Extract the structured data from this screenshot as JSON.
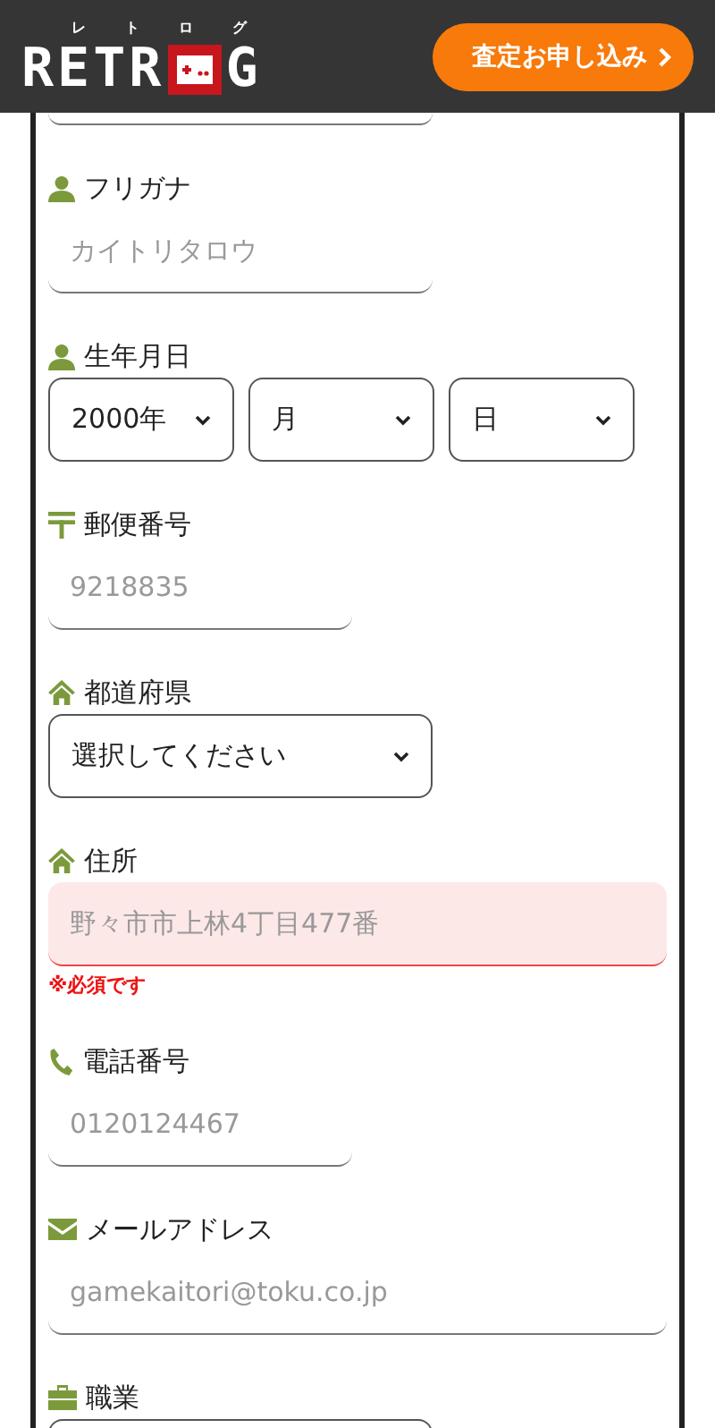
{
  "header": {
    "logo": {
      "before": "RETR",
      "after": "G",
      "ruby": [
        "レ",
        "ト",
        "ロ",
        "グ"
      ]
    },
    "cta": {
      "label": "査定お申し込み"
    }
  },
  "fields": [
    {
      "label": "フリガナ",
      "kind": "text",
      "placeholder": "カイトリタロウ"
    },
    {
      "label": "生年月日",
      "kind": "date",
      "selects": [
        {
          "value": "2000年"
        },
        {
          "value": "月"
        },
        {
          "value": "日"
        }
      ]
    },
    {
      "label": "郵便番号",
      "kind": "short_text",
      "placeholder": "9218835"
    },
    {
      "label": "都道府県",
      "kind": "select",
      "value": "選択してください"
    },
    {
      "label": "住所",
      "kind": "wide_text",
      "placeholder": "野々市市上林4丁目477番",
      "invalid": true,
      "error": "※必須です"
    },
    {
      "label": "電話番号",
      "kind": "short_text",
      "placeholder": "0120124467"
    },
    {
      "label": "メールアドレス",
      "kind": "wide_text",
      "placeholder": "gamekaitori@toku.co.jp"
    },
    {
      "label": "職業",
      "kind": "select"
    }
  ]
}
